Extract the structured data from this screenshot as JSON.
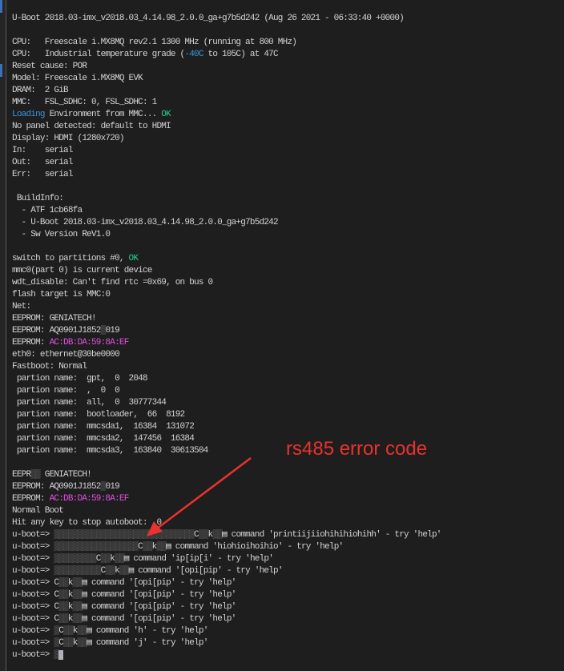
{
  "annotation": {
    "label": "rs485 error code",
    "color": "#e8322f"
  },
  "colors": {
    "background": "#1e1e1e",
    "text": "#d4d4d4",
    "blue": "#3a96dd",
    "green": "#23d18b",
    "magenta": "#e34fe3"
  },
  "lines": [
    [
      {
        "t": "U-Boot 2018.03-imx_v2018.03_4.14.98_2.0.0_ga+g7b5d242 (Aug 26 2021 - 06:33:40 +0000)"
      }
    ],
    [],
    [
      {
        "t": "CPU:   Freescale i.MX8MQ rev2.1 1300 MHz (running at 800 MHz)"
      }
    ],
    [
      {
        "t": "CPU:   Industrial temperature grade ("
      },
      {
        "t": "-40C",
        "c": "blue"
      },
      {
        "t": " to 105C) at 47C"
      }
    ],
    [
      {
        "t": "Reset cause: POR"
      }
    ],
    [
      {
        "t": "Model: Freescale i.MX8MQ EVK"
      }
    ],
    [
      {
        "t": "DRAM:  2 GiB"
      }
    ],
    [
      {
        "t": "MMC:   FSL_SDHC: 0, FSL_SDHC: 1"
      }
    ],
    [
      {
        "t": "Loading",
        "c": "blue"
      },
      {
        "t": " Environment from MMC... "
      },
      {
        "t": "OK",
        "c": "green"
      }
    ],
    [
      {
        "t": "No panel detected: default to HDMI"
      }
    ],
    [
      {
        "t": "Display: HDMI (1280x720)"
      }
    ],
    [
      {
        "t": "In:    serial"
      }
    ],
    [
      {
        "t": "Out:   serial"
      }
    ],
    [
      {
        "t": "Err:   serial"
      }
    ],
    [],
    [
      {
        "t": " BuildInfo:"
      }
    ],
    [
      {
        "t": "  - ATF 1cb68fa"
      }
    ],
    [
      {
        "t": "  - U-Boot 2018.03-imx_v2018.03_4.14.98_2.0.0_ga+g7b5d242"
      }
    ],
    [
      {
        "t": "  - Sw Version ReV1.0"
      }
    ],
    [],
    [
      {
        "t": "switch to partitions #0, "
      },
      {
        "t": "OK",
        "c": "green"
      }
    ],
    [
      {
        "t": "mmc0(part 0) is current device"
      }
    ],
    [
      {
        "t": "wdt_disable: Can't find rtc =0x69, on bus 0"
      }
    ],
    [
      {
        "t": "flash target is MMC:0"
      }
    ],
    [
      {
        "t": "Net:"
      }
    ],
    [
      {
        "t": "EEPROM: GENIATECH!"
      }
    ],
    [
      {
        "t": "EEPROM: AQ0901J1852"
      },
      {
        "t": "▒",
        "c": "garble"
      },
      {
        "t": "019"
      }
    ],
    [
      {
        "t": "EEPROM: "
      },
      {
        "t": "AC:DB:DA:59:8A:EF",
        "c": "magenta"
      }
    ],
    [
      {
        "t": "eth0: ethernet@30be0000"
      }
    ],
    [
      {
        "t": "Fastboot: Normal"
      }
    ],
    [
      {
        "t": " partion name:  gpt,  0  2048"
      }
    ],
    [
      {
        "t": " partion name:  ,  0  0"
      }
    ],
    [
      {
        "t": " partion name:  all,  0  30777344"
      }
    ],
    [
      {
        "t": " partion name:  bootloader,  66  8192"
      }
    ],
    [
      {
        "t": " partion name:  mmcsda1,  16384  131072"
      }
    ],
    [
      {
        "t": " partion name:  mmcsda2,  147456  16384"
      }
    ],
    [
      {
        "t": " partion name:  mmcsda3,  163840  30613504"
      }
    ],
    [],
    [
      {
        "t": "EEPR"
      },
      {
        "t": "▒▒",
        "c": "garble"
      },
      {
        "t": " GENIATECH!"
      }
    ],
    [
      {
        "t": "EEPROM: AQ0901J1852"
      },
      {
        "t": "▒",
        "c": "garble"
      },
      {
        "t": "019"
      }
    ],
    [
      {
        "t": "EEPROM: "
      },
      {
        "t": "AC:DB:DA:59:8A:EF",
        "c": "magenta"
      }
    ],
    [
      {
        "t": "Normal Boot"
      }
    ],
    [
      {
        "t": "Hit any key to stop autoboot:  0"
      }
    ],
    [
      {
        "t": "u-boot=> "
      },
      {
        "t": "▒▒▒▒▒▒▒▒▒▒▒▒▒▒▒▒▒▒▒▒▒▒▒▒▒▒▒▒▒▒",
        "c": "garble"
      },
      {
        "t": "C"
      },
      {
        "t": "▒▒",
        "c": "garble"
      },
      {
        "t": "k"
      },
      {
        "t": "▒▒",
        "c": "garble"
      },
      {
        "t": "▤ command 'printiijiiohihihiohihh' - try 'help'"
      }
    ],
    [
      {
        "t": "u-boot=> "
      },
      {
        "t": "▒▒▒▒▒▒▒▒▒▒▒▒▒▒▒▒▒▒",
        "c": "garble"
      },
      {
        "t": "C"
      },
      {
        "t": "▒▒",
        "c": "garble"
      },
      {
        "t": "k"
      },
      {
        "t": "▒▒",
        "c": "garble"
      },
      {
        "t": "▤ command 'hiohioihoihio' - try 'help'"
      }
    ],
    [
      {
        "t": "u-boot=> "
      },
      {
        "t": "▒▒▒▒▒▒▒▒▒",
        "c": "garble"
      },
      {
        "t": "C"
      },
      {
        "t": "▒▒",
        "c": "garble"
      },
      {
        "t": "k"
      },
      {
        "t": "▒▒",
        "c": "garble"
      },
      {
        "t": "▤ command 'ip[ip[i' - try 'help'"
      }
    ],
    [
      {
        "t": "u-boot=> "
      },
      {
        "t": "▒▒▒▒▒▒▒▒▒▒",
        "c": "garble"
      },
      {
        "t": "C"
      },
      {
        "t": "▒▒",
        "c": "garble"
      },
      {
        "t": "k"
      },
      {
        "t": "▒▒",
        "c": "garble"
      },
      {
        "t": "▤ command '[opi[pip' - try 'help'"
      }
    ],
    [
      {
        "t": "u-boot=> C"
      },
      {
        "t": "▒▒",
        "c": "garble"
      },
      {
        "t": "k"
      },
      {
        "t": "▒▒",
        "c": "garble"
      },
      {
        "t": "▤ command '[opi[pip' - try 'help'"
      }
    ],
    [
      {
        "t": "u-boot=> C"
      },
      {
        "t": "▒▒",
        "c": "garble"
      },
      {
        "t": "k"
      },
      {
        "t": "▒▒",
        "c": "garble"
      },
      {
        "t": "▤ command '[opi[pip' - try 'help'"
      }
    ],
    [
      {
        "t": "u-boot=> C"
      },
      {
        "t": "▒▒",
        "c": "garble"
      },
      {
        "t": "k"
      },
      {
        "t": "▒▒",
        "c": "garble"
      },
      {
        "t": "▤ command '[opi[pip' - try 'help'"
      }
    ],
    [
      {
        "t": "u-boot=> C"
      },
      {
        "t": "▒▒",
        "c": "garble"
      },
      {
        "t": "k"
      },
      {
        "t": "▒▒",
        "c": "garble"
      },
      {
        "t": "▤ command '[opi[pip' - try 'help'"
      }
    ],
    [
      {
        "t": "u-boot=> "
      },
      {
        "t": "▒",
        "c": "garble"
      },
      {
        "t": "C"
      },
      {
        "t": "▒▒",
        "c": "garble"
      },
      {
        "t": "k"
      },
      {
        "t": "▒▒",
        "c": "garble"
      },
      {
        "t": "▤ command 'h' - try 'help'"
      }
    ],
    [
      {
        "t": "u-boot=> "
      },
      {
        "t": "▒",
        "c": "garble"
      },
      {
        "t": "C"
      },
      {
        "t": "▒▒",
        "c": "garble"
      },
      {
        "t": "k"
      },
      {
        "t": "▒▒",
        "c": "garble"
      },
      {
        "t": "▤ command 'j' - try 'help'"
      }
    ],
    [
      {
        "t": "u-boot=> "
      },
      {
        "t": "▒",
        "c": "garble"
      },
      {
        "t": " ",
        "c": "cursor"
      }
    ]
  ]
}
